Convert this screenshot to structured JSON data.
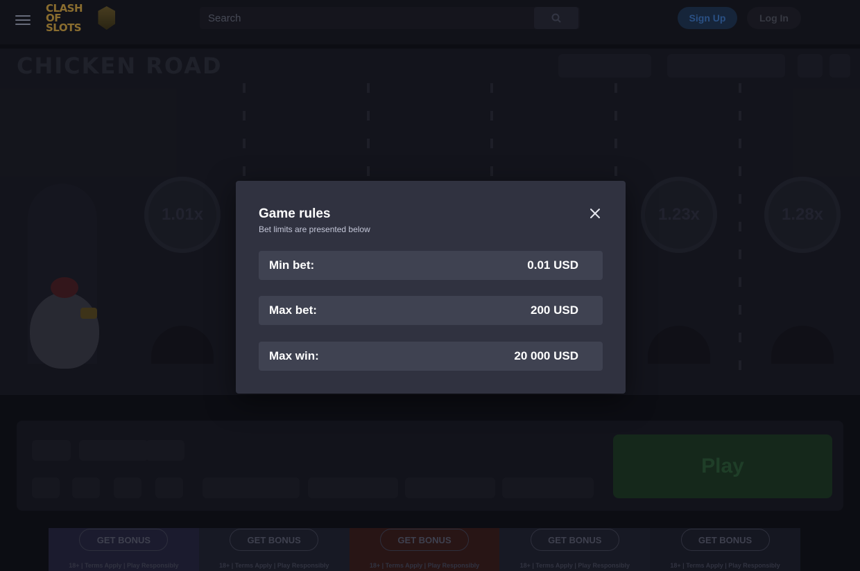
{
  "topnav": {
    "logo_text": "Clash of Slots",
    "search_placeholder": "Search",
    "signup_label": "Sign Up",
    "login_label": "Log In"
  },
  "modal": {
    "title": "Game rules",
    "subtitle": "Bet limits are presented below",
    "rows": [
      {
        "label": "Min bet:",
        "value": "0.01 USD"
      },
      {
        "label": "Max bet:",
        "value": "200 USD"
      },
      {
        "label": "Max win:",
        "value": "20 000 USD"
      }
    ]
  },
  "game": {
    "logo_text": "CHICKEN ROAD",
    "multipliers": [
      "1.01x",
      "1.23x",
      "1.28x"
    ],
    "play_label": "Play"
  },
  "promos": [
    {
      "button": "GET BONUS",
      "note": "18+ | Terms Apply | Play Responsibly",
      "color": "#262540"
    },
    {
      "button": "GET BONUS",
      "note": "18+ | Terms Apply | Play Responsibly",
      "color": "#1f2330"
    },
    {
      "button": "GET BONUS",
      "note": "18+ | Terms Apply | Play Responsibly",
      "color": "#3a1c1a"
    },
    {
      "button": "GET BONUS",
      "note": "18+ | Terms Apply | Play Responsibly",
      "color": "#202330"
    },
    {
      "button": "GET BONUS",
      "note": "18+ | Terms Apply | Play Responsibly",
      "color": "#1c1f2b"
    }
  ],
  "colors": {
    "modal_bg": "#303240",
    "row_bg": "#3f4251",
    "accent_blue": "#3c77c4"
  }
}
